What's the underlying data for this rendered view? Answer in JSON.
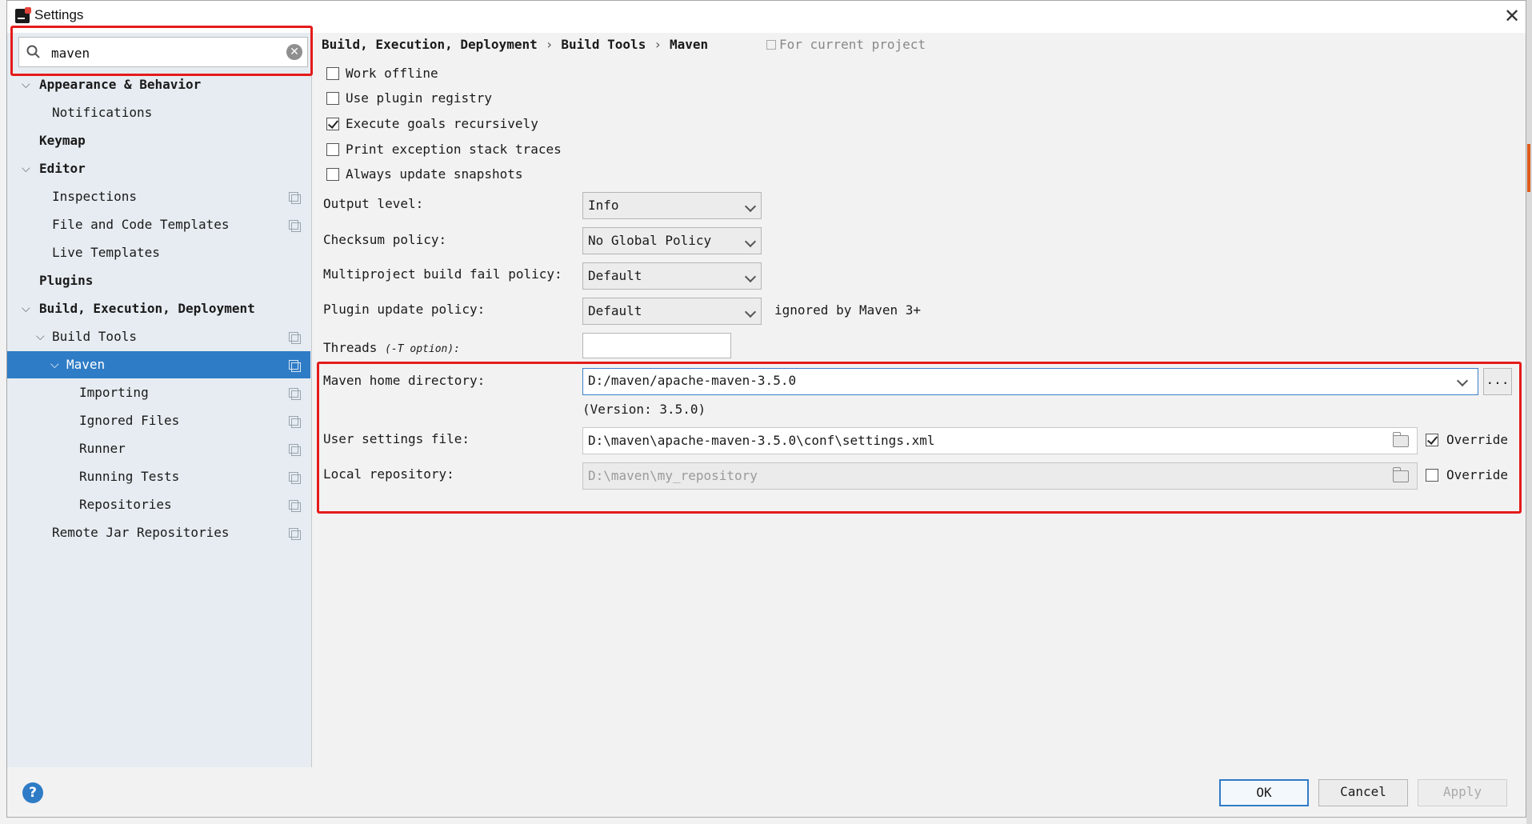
{
  "window": {
    "title": "Settings"
  },
  "search": {
    "value": "maven"
  },
  "sidebar": {
    "items": [
      {
        "label": "Appearance & Behavior"
      },
      {
        "label": "Notifications"
      },
      {
        "label": "Keymap"
      },
      {
        "label": "Editor"
      },
      {
        "label": "Inspections"
      },
      {
        "label": "File and Code Templates"
      },
      {
        "label": "Live Templates"
      },
      {
        "label": "Plugins"
      },
      {
        "label": "Build, Execution, Deployment"
      },
      {
        "label": "Build Tools"
      },
      {
        "label": "Maven"
      },
      {
        "label": "Importing"
      },
      {
        "label": "Ignored Files"
      },
      {
        "label": "Runner"
      },
      {
        "label": "Running Tests"
      },
      {
        "label": "Repositories"
      },
      {
        "label": "Remote Jar Repositories"
      }
    ]
  },
  "breadcrumb": {
    "part1": "Build, Execution, Deployment",
    "part2": "Build Tools",
    "part3": "Maven",
    "sep": "›"
  },
  "scope": {
    "label": "For current project"
  },
  "options": {
    "work_offline": {
      "label": "Work offline",
      "checked": false
    },
    "use_plugin_registry": {
      "label": "Use plugin registry",
      "checked": false
    },
    "execute_goals": {
      "label": "Execute goals recursively",
      "checked": true
    },
    "print_exception": {
      "label": "Print exception stack traces",
      "checked": false
    },
    "always_update": {
      "label": "Always update snapshots",
      "checked": false
    }
  },
  "fields": {
    "output_level": {
      "label": "Output level:",
      "value": "Info"
    },
    "checksum_policy": {
      "label": "Checksum policy:",
      "value": "No Global Policy"
    },
    "multiproject_policy": {
      "label": "Multiproject build fail policy:",
      "value": "Default"
    },
    "plugin_update_policy": {
      "label": "Plugin update policy:",
      "value": "Default",
      "note": "ignored by Maven 3+"
    },
    "threads": {
      "label": "Threads",
      "option": "(-T option):",
      "value": ""
    },
    "maven_home": {
      "label": "Maven home directory:",
      "value": "D:/maven/apache-maven-3.5.0",
      "version": "(Version: 3.5.0)",
      "browse": "..."
    },
    "user_settings": {
      "label": "User settings file:",
      "value": "D:\\maven\\apache-maven-3.5.0\\conf\\settings.xml",
      "override_label": "Override",
      "override": true
    },
    "local_repo": {
      "label": "Local repository:",
      "value": "D:\\maven\\my_repository",
      "override_label": "Override",
      "override": false
    }
  },
  "buttons": {
    "ok": "OK",
    "cancel": "Cancel",
    "apply": "Apply",
    "help": "?"
  },
  "colors": {
    "selection": "#2f7cc6",
    "annotation": "#e51b1b",
    "sidebar_bg": "#e6ecf1"
  }
}
